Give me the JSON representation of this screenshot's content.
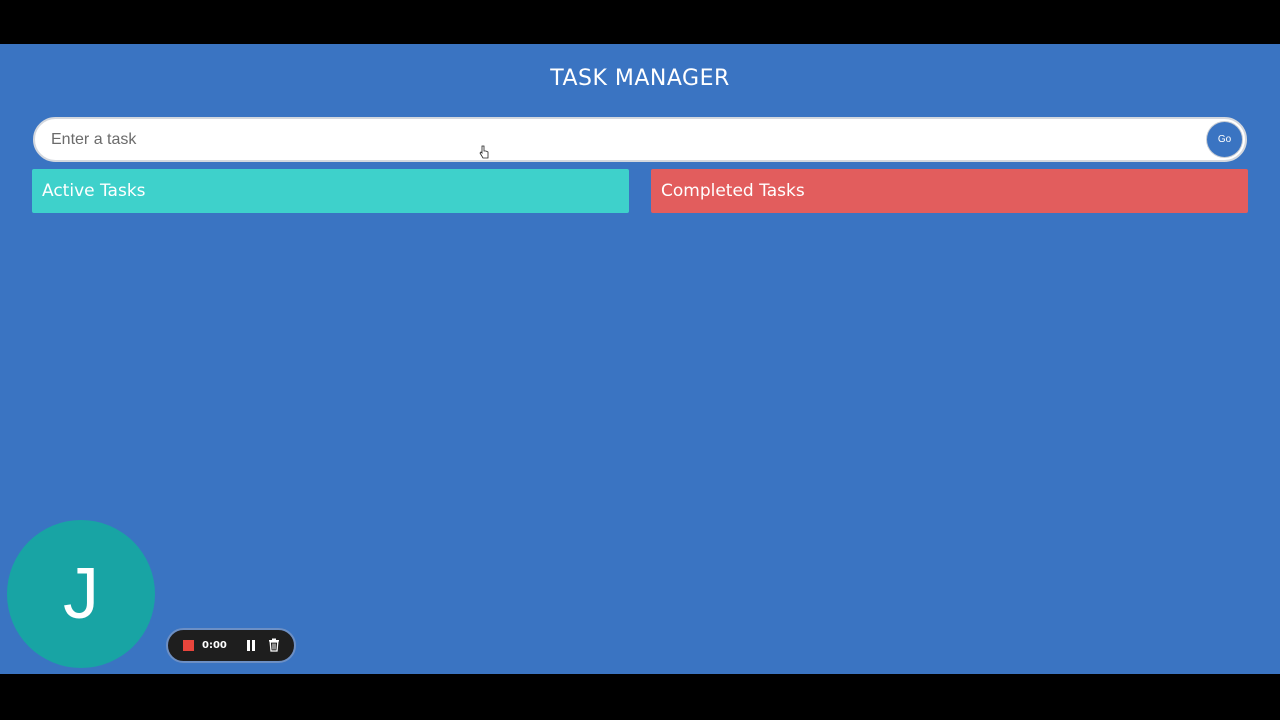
{
  "app": {
    "title": "TASK MANAGER"
  },
  "task_form": {
    "input_value": "",
    "input_placeholder": "Enter a task",
    "go_label": "Go"
  },
  "panels": {
    "active_label": "Active Tasks",
    "completed_label": "Completed Tasks"
  },
  "avatar": {
    "initial": "J"
  },
  "recorder": {
    "time": "0:00",
    "stop_icon": "stop-icon",
    "pause_icon": "pause-icon",
    "trash_icon": "trash-icon"
  },
  "colors": {
    "background": "#3a74c2",
    "active_panel": "#3ed1cb",
    "completed_panel": "#e25d5d",
    "avatar": "#18a4a4",
    "recorder_stop": "#e8453c"
  }
}
